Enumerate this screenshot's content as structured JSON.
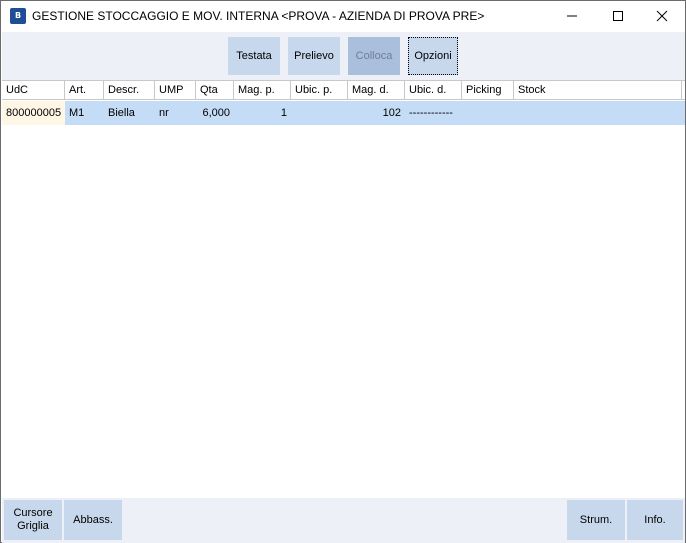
{
  "window": {
    "title": "GESTIONE STOCCAGGIO E MOV. INTERNA <PROVA - AZIENDA DI PROVA PRE>",
    "icon_text": "B"
  },
  "toolbar": {
    "buttons": [
      {
        "label": "Testata",
        "state": "normal"
      },
      {
        "label": "Prelievo",
        "state": "normal"
      },
      {
        "label": "Colloca",
        "state": "disabled"
      },
      {
        "label": "Opzioni",
        "state": "focused"
      }
    ]
  },
  "grid": {
    "columns": [
      "UdC",
      "Art.",
      "Descr.",
      "UMP",
      "Qta",
      "Mag. p.",
      "Ubic. p.",
      "Mag. d.",
      "Ubic. d.",
      "Picking",
      "Stock"
    ],
    "rows": [
      {
        "udc": "800000005",
        "art": "M1",
        "descr": "Biella",
        "ump": "nr",
        "qta": "6,000",
        "mag_p": "1",
        "ubic_p": "",
        "mag_d": "102",
        "ubic_d": "------------",
        "picking": "",
        "stock": ""
      }
    ]
  },
  "footer": {
    "cursore_line1": "Cursore",
    "cursore_line2": "Griglia",
    "abbass": "Abbass.",
    "strum": "Strum.",
    "info": "Info."
  },
  "colors": {
    "button_bg": "#c8d8ec",
    "button_disabled_bg": "#a9bfdb",
    "toolbar_bg": "#eef0f7",
    "selected_row_bg": "#c4dcf6"
  }
}
